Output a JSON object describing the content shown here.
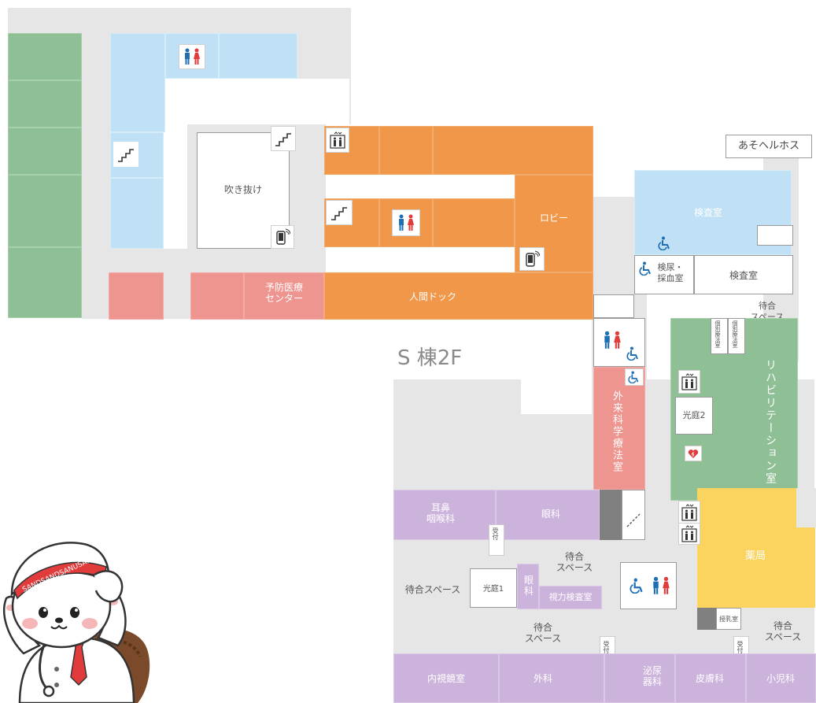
{
  "floor_label": "S 棟2F",
  "sign_label": "あそヘルホス",
  "rooms": {
    "atrium": "吹き抜け",
    "lobby": "ロビー",
    "prevention_center": "予防医療\nセンター",
    "health_check": "人間ドック",
    "exam_room_top": "検査室",
    "urine_blood": "検尿・\n採血室",
    "exam_room_2": "検査室",
    "waiting_right_top": "待合\nスペース",
    "outpatient_chemo": "外来科学療法室",
    "rehab": "リハビリテーション室",
    "small_room_a": "個別療法室",
    "small_room_b": "個別療法室",
    "courtyard2": "光庭2",
    "pharmacy": "薬局",
    "ent": "耳鼻\n咽喉科",
    "ophthalmology": "眼科",
    "reception_1": "受付",
    "waiting_center": "待合\nスペース",
    "waiting_left": "待合スペース",
    "courtyard1": "光庭1",
    "eye_small": "眼\n科",
    "vision_test": "視力検査室",
    "waiting_bottom": "待合\nスペース",
    "reception_2": "受付",
    "reception_3": "受付",
    "milk_room": "授乳室",
    "waiting_right_bottom": "待合\nスペース",
    "endoscopy": "内視鏡室",
    "surgery": "外科",
    "urology": "泌尿\n器科",
    "dermatology": "皮膚科",
    "pediatrics": "小児科"
  },
  "mascot": {
    "hat_text": "SANDSANDSANUSAN"
  },
  "colors": {
    "corridor": "#e6e6e6",
    "green": "#8fbf95",
    "blue": "#bfe0f5",
    "orange": "#f0974a",
    "pink": "#ef9590",
    "purple": "#ccb3dc",
    "yellow": "#fad45f",
    "icon_blue": "#1f6fb5",
    "icon_red": "#e23b3b"
  }
}
